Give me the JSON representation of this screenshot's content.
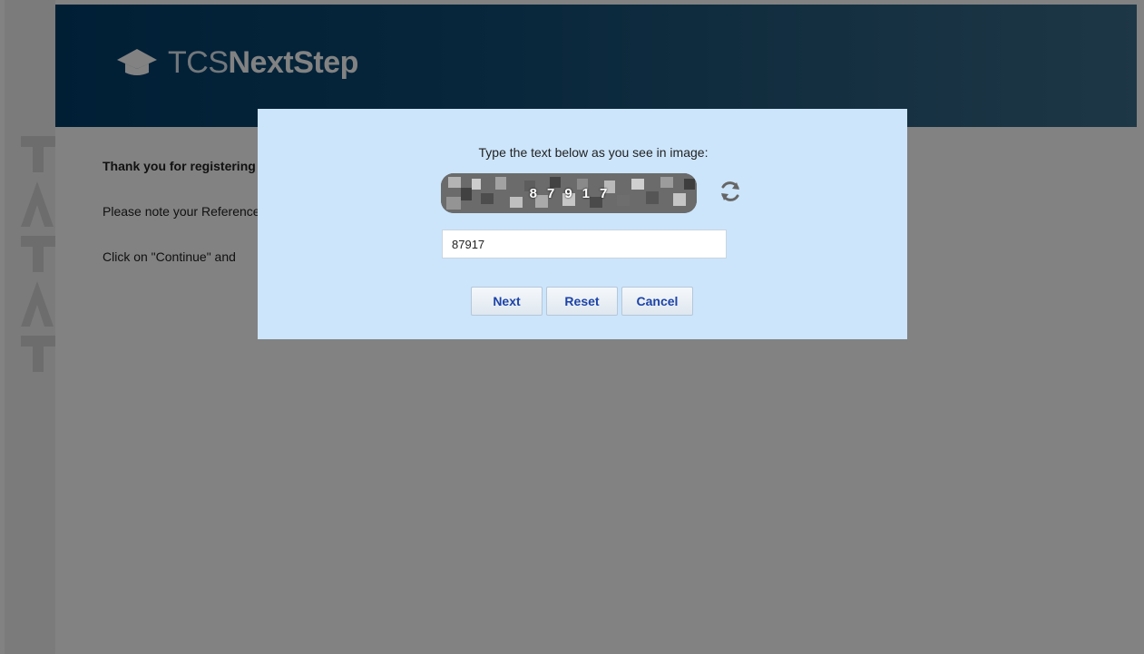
{
  "header": {
    "logo_prefix": "TCS",
    "logo_suffix": "NextStep"
  },
  "content": {
    "line1": "Thank you for registering",
    "line2": "Please note your Reference",
    "line3": "Click on \"Continue\" and"
  },
  "dialog": {
    "prompt": "Type the text below as you see in image:",
    "captcha_chars": [
      "8",
      "7",
      "9",
      "1",
      "7"
    ],
    "input_value": "87917",
    "buttons": {
      "next": "Next",
      "reset": "Reset",
      "cancel": "Cancel"
    }
  },
  "colors": {
    "header_start": "#013d69",
    "header_end": "#3b6c8a",
    "dialog_bg": "#cce5fb",
    "button_text": "#1d43a8"
  },
  "icons": {
    "logo": "graduation-cap-icon",
    "refresh": "refresh-icon"
  }
}
